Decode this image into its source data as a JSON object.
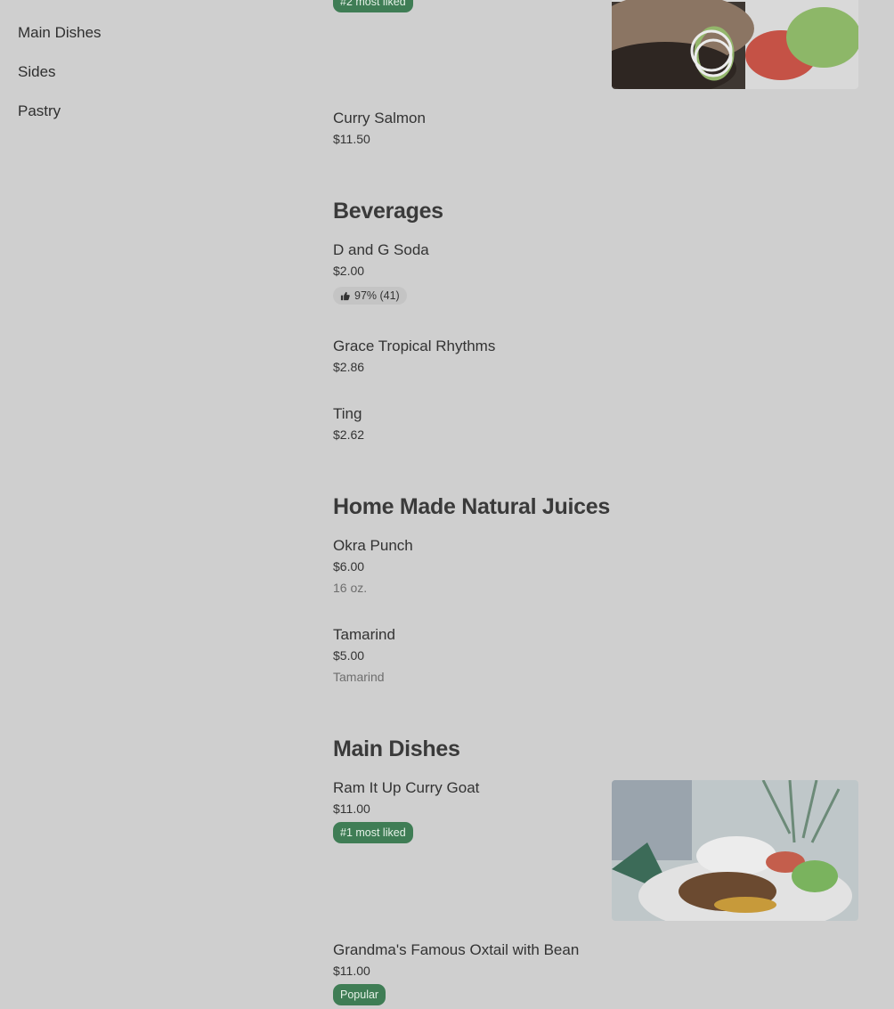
{
  "sidebar": {
    "items": [
      "Main Dishes",
      "Sides",
      "Pastry"
    ]
  },
  "top_item": {
    "badge": "#2 most liked"
  },
  "items": {
    "curry_salmon": {
      "name": "Curry Salmon",
      "price": "$11.50"
    },
    "dg_soda": {
      "name": "D and G Soda",
      "price": "$2.00",
      "rating": "97% (41)"
    },
    "grace": {
      "name": "Grace Tropical Rhythms",
      "price": "$2.86"
    },
    "ting": {
      "name": "Ting",
      "price": "$2.62"
    },
    "okra": {
      "name": "Okra Punch",
      "price": "$6.00",
      "desc": "16 oz."
    },
    "tamarind": {
      "name": "Tamarind",
      "price": "$5.00",
      "desc": "Tamarind"
    },
    "curry_goat": {
      "name": "Ram It Up Curry Goat",
      "price": "$11.00",
      "badge": "#1 most liked"
    },
    "oxtail": {
      "name": "Grandma's Famous Oxtail with Bean",
      "price": "$11.00",
      "badge": "Popular"
    }
  },
  "sections": {
    "beverages": "Beverages",
    "juices": "Home Made Natural Juices",
    "main_dishes": "Main Dishes"
  },
  "colors": {
    "badge_green": "#3f7d55",
    "overlay_bg": "#cfcfcf"
  },
  "icons": {
    "rating": "thumbs-up-icon"
  }
}
